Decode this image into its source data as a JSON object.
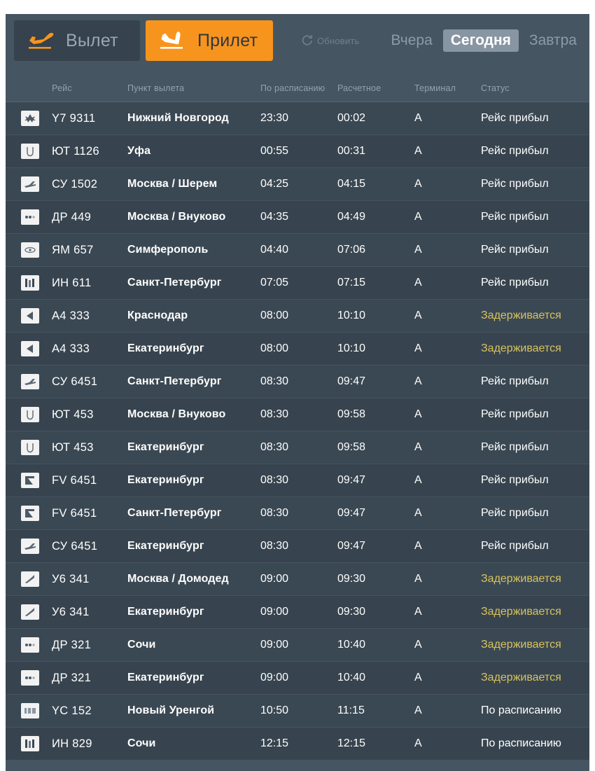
{
  "colors": {
    "board_bg": "#465562",
    "accent_orange": "#f7941e",
    "row_bg": "#3a4853",
    "row_alt_bg": "#37444f",
    "delayed": "#d8c25f",
    "muted_text": "#94a2ad",
    "active_day_bg": "#8895a2"
  },
  "toolbar": {
    "tab_departure": {
      "label": "Вылет",
      "icon": "plane-takeoff-icon",
      "active": false
    },
    "tab_arrival": {
      "label": "Прилет",
      "icon": "plane-landing-icon",
      "active": true
    },
    "refresh": {
      "label": "Обновить",
      "icon": "refresh-icon"
    },
    "days": [
      {
        "label": "Вчера",
        "active": false
      },
      {
        "label": "Сегодня",
        "active": true
      },
      {
        "label": "Завтра",
        "active": false
      }
    ]
  },
  "table": {
    "headers": {
      "logo": "",
      "flight": "Рейс",
      "point": "Пункт вылета",
      "scheduled": "По расписанию",
      "estimated": "Расчетное",
      "terminal": "Терминал",
      "status": "Статус"
    },
    "rows": [
      {
        "logo": "airline-y7-icon",
        "flight": "Y7 9311",
        "point": "Нижний Новгород",
        "scheduled": "23:30",
        "estimated": "00:02",
        "terminal": "A",
        "status": "Рейс прибыл",
        "delayed": false
      },
      {
        "logo": "airline-ut-icon",
        "flight": "ЮТ 1126",
        "point": "Уфа",
        "scheduled": "00:55",
        "estimated": "00:31",
        "terminal": "A",
        "status": "Рейс прибыл",
        "delayed": false
      },
      {
        "logo": "airline-su-icon",
        "flight": "СУ 1502",
        "point": "Москва / Шерем",
        "scheduled": "04:25",
        "estimated": "04:15",
        "terminal": "A",
        "status": "Рейс прибыл",
        "delayed": false
      },
      {
        "logo": "airline-dp-icon",
        "flight": "ДР 449",
        "point": "Москва / Внуково",
        "scheduled": "04:35",
        "estimated": "04:49",
        "terminal": "A",
        "status": "Рейс прибыл",
        "delayed": false
      },
      {
        "logo": "airline-ym-icon",
        "flight": "ЯМ 657",
        "point": "Симферополь",
        "scheduled": "04:40",
        "estimated": "07:06",
        "terminal": "A",
        "status": "Рейс прибыл",
        "delayed": false
      },
      {
        "logo": "airline-in-icon",
        "flight": "ИН 611",
        "point": "Санкт-Петербург",
        "scheduled": "07:05",
        "estimated": "07:15",
        "terminal": "A",
        "status": "Рейс прибыл",
        "delayed": false
      },
      {
        "logo": "airline-a4-icon",
        "flight": "А4 333",
        "point": "Краснодар",
        "scheduled": "08:00",
        "estimated": "10:10",
        "terminal": "A",
        "status": "Задерживается",
        "delayed": true
      },
      {
        "logo": "airline-a4-icon",
        "flight": "А4 333",
        "point": "Екатеринбург",
        "scheduled": "08:00",
        "estimated": "10:10",
        "terminal": "A",
        "status": "Задерживается",
        "delayed": true
      },
      {
        "logo": "airline-su-icon",
        "flight": "СУ 6451",
        "point": "Санкт-Петербург",
        "scheduled": "08:30",
        "estimated": "09:47",
        "terminal": "A",
        "status": "Рейс прибыл",
        "delayed": false
      },
      {
        "logo": "airline-ut-icon",
        "flight": "ЮТ 453",
        "point": "Москва / Внуково",
        "scheduled": "08:30",
        "estimated": "09:58",
        "terminal": "A",
        "status": "Рейс прибыл",
        "delayed": false
      },
      {
        "logo": "airline-ut-icon",
        "flight": "ЮТ 453",
        "point": "Екатеринбург",
        "scheduled": "08:30",
        "estimated": "09:58",
        "terminal": "A",
        "status": "Рейс прибыл",
        "delayed": false
      },
      {
        "logo": "airline-fv-icon",
        "flight": "FV 6451",
        "point": "Екатеринбург",
        "scheduled": "08:30",
        "estimated": "09:47",
        "terminal": "A",
        "status": "Рейс прибыл",
        "delayed": false
      },
      {
        "logo": "airline-fv-icon",
        "flight": "FV 6451",
        "point": "Санкт-Петербург",
        "scheduled": "08:30",
        "estimated": "09:47",
        "terminal": "A",
        "status": "Рейс прибыл",
        "delayed": false
      },
      {
        "logo": "airline-su-icon",
        "flight": "СУ 6451",
        "point": "Екатеринбург",
        "scheduled": "08:30",
        "estimated": "09:47",
        "terminal": "A",
        "status": "Рейс прибыл",
        "delayed": false
      },
      {
        "logo": "airline-u6-icon",
        "flight": "У6 341",
        "point": "Москва / Домодед",
        "scheduled": "09:00",
        "estimated": "09:30",
        "terminal": "A",
        "status": "Задерживается",
        "delayed": true
      },
      {
        "logo": "airline-u6-icon",
        "flight": "У6 341",
        "point": "Екатеринбург",
        "scheduled": "09:00",
        "estimated": "09:30",
        "terminal": "A",
        "status": "Задерживается",
        "delayed": true
      },
      {
        "logo": "airline-dp-icon",
        "flight": "ДР 321",
        "point": "Сочи",
        "scheduled": "09:00",
        "estimated": "10:40",
        "terminal": "A",
        "status": "Задерживается",
        "delayed": true
      },
      {
        "logo": "airline-dp-icon",
        "flight": "ДР 321",
        "point": "Екатеринбург",
        "scheduled": "09:00",
        "estimated": "10:40",
        "terminal": "A",
        "status": "Задерживается",
        "delayed": true
      },
      {
        "logo": "airline-yc-icon",
        "flight": "YC 152",
        "point": "Новый Уренгой",
        "scheduled": "10:50",
        "estimated": "11:15",
        "terminal": "A",
        "status": "По расписанию",
        "delayed": false
      },
      {
        "logo": "airline-in-icon",
        "flight": "ИН 829",
        "point": "Сочи",
        "scheduled": "12:15",
        "estimated": "12:15",
        "terminal": "A",
        "status": "По расписанию",
        "delayed": false
      }
    ]
  }
}
